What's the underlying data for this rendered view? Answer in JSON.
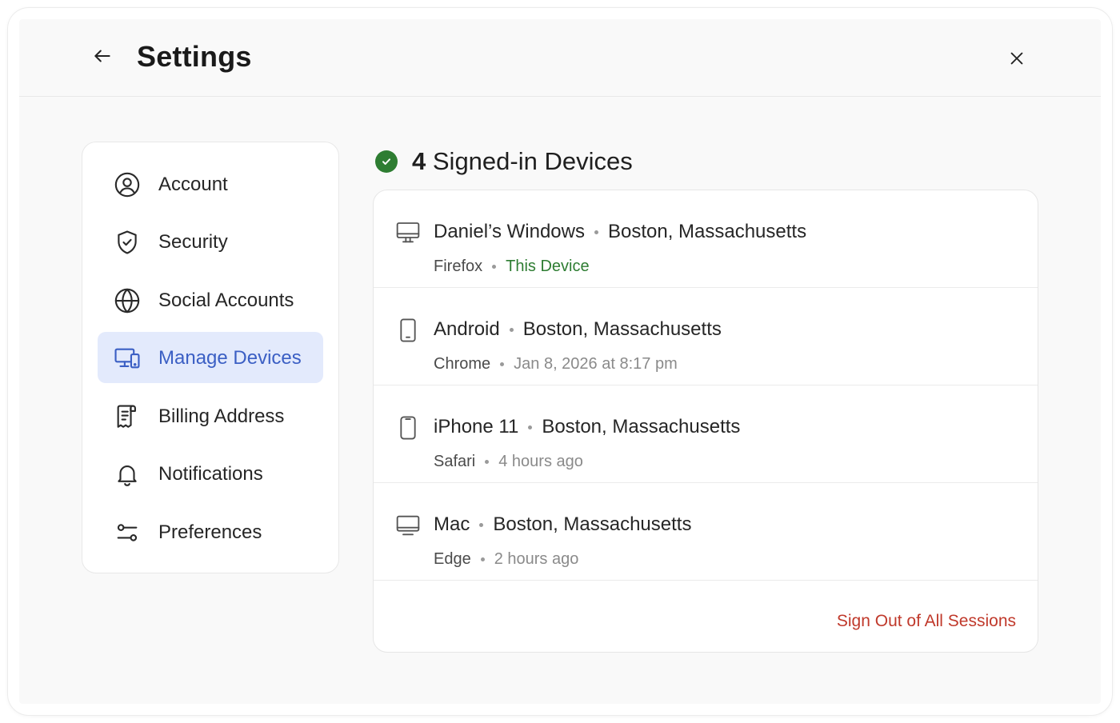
{
  "header": {
    "title": "Settings",
    "back_icon": "arrow-left-icon",
    "close_icon": "close-icon"
  },
  "sidebar": {
    "items": [
      {
        "label": "Account",
        "icon": "user-circle-icon",
        "active": false
      },
      {
        "label": "Security",
        "icon": "shield-check-icon",
        "active": false
      },
      {
        "label": "Social Accounts",
        "icon": "globe-icon",
        "active": false
      },
      {
        "label": "Manage Devices",
        "icon": "devices-icon",
        "active": true
      },
      {
        "label": "Billing Address",
        "icon": "receipt-icon",
        "active": false
      },
      {
        "label": "Notifications",
        "icon": "bell-icon",
        "active": false
      },
      {
        "label": "Preferences",
        "icon": "sliders-icon",
        "active": false
      }
    ]
  },
  "main": {
    "count": "4",
    "heading_suffix": "Signed-in Devices",
    "devices": [
      {
        "name": "Daniel’s Windows",
        "location": "Boston, Massachusetts",
        "browser": "Firefox",
        "status": "This Device",
        "icon": "desktop-icon"
      },
      {
        "name": "Android",
        "location": "Boston, Massachusetts",
        "browser": "Chrome",
        "status": "Jan 8, 2026 at 8:17 pm",
        "icon": "phone-icon"
      },
      {
        "name": "iPhone 11",
        "location": "Boston, Massachusetts",
        "browser": "Safari",
        "status": "4 hours ago",
        "icon": "iphone-icon"
      },
      {
        "name": "Mac",
        "location": "Boston, Massachusetts",
        "browser": "Edge",
        "status": "2 hours ago",
        "icon": "laptop-icon"
      }
    ],
    "sign_out_label": "Sign Out of All Sessions"
  },
  "colors": {
    "accent": "#3b5fc4",
    "active_bg": "#e3eafc",
    "success": "#2e7d32",
    "danger": "#c0392b"
  }
}
